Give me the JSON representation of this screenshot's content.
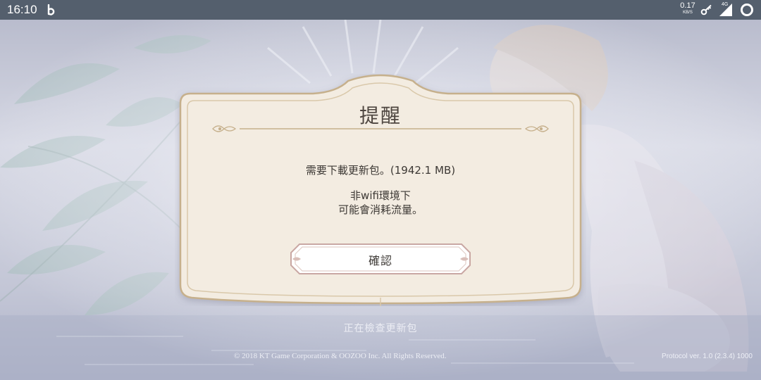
{
  "status_bar": {
    "time": "16:10",
    "app_icon": "b-logo-icon",
    "net_speed": "0.17",
    "net_speed_unit": "KB/S",
    "network": "4G",
    "icons": [
      "vpn-key-icon",
      "signal-icon",
      "battery-ring-icon"
    ]
  },
  "dialog": {
    "title": "提醒",
    "message_line1": "需要下載更新包。(1942.1 MB)",
    "message_line2": "非wifi環境下",
    "message_line3": "可能會消耗流量。",
    "confirm_label": "確認"
  },
  "footer": {
    "status_text": "正在檢查更新包",
    "copyright": "© 2018 KT Game Corporation & OOZOO Inc. All Rights Reserved.",
    "version": "Protocol ver. 1.0 (2.3.4) 1000"
  },
  "colors": {
    "status_bar": "#545f6d",
    "dialog_fill": "#f1e9dd",
    "dialog_border": "#c7b18e",
    "text": "#3d3935"
  }
}
